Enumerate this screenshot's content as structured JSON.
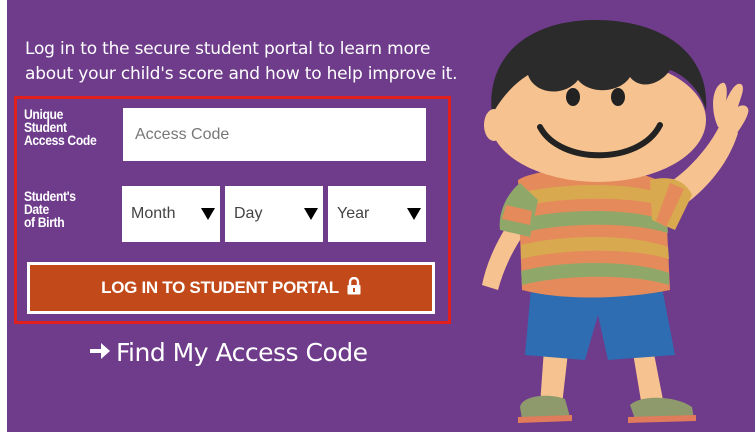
{
  "intro_text": "Log in to the secure student portal to learn more about your child's score and how to help improve it.",
  "form": {
    "access_label": [
      "Unique",
      "Student",
      "Access Code"
    ],
    "access_placeholder": "Access Code",
    "dob_label": [
      "Student's",
      "Date",
      "of Birth"
    ],
    "month": "Month",
    "day": "Day",
    "year": "Year",
    "login_button": "LOG IN TO STUDENT PORTAL"
  },
  "find_link": "Find My Access Code",
  "colors": {
    "background": "#6f3b8b",
    "button": "#c24a1a",
    "highlight_border": "#e0201c"
  },
  "icons": {
    "lock": "lock-icon",
    "arrow": "arrow-right-icon"
  }
}
